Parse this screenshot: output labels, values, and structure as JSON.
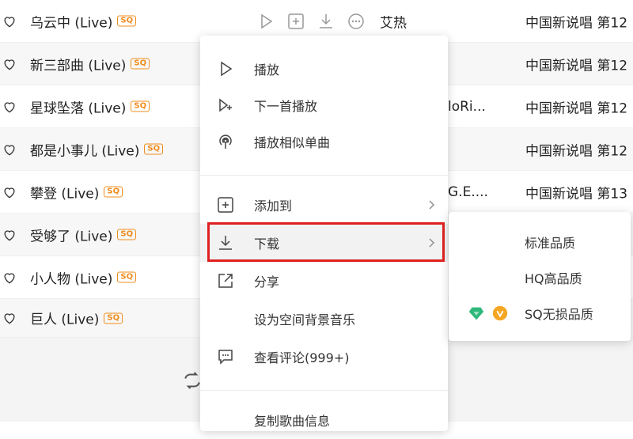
{
  "songs": [
    {
      "title": "乌云中 (Live)",
      "badge": "SQ",
      "artist": "艾热",
      "album": "中国新说唱 第12"
    },
    {
      "title": "新三部曲 (Live)",
      "badge": "SQ",
      "artist": "",
      "album": "中国新说唱 第12"
    },
    {
      "title": "星球坠落 (Live)",
      "badge": "SQ",
      "artist": "loRi...",
      "album": "中国新说唱 第12"
    },
    {
      "title": "都是小事儿 (Live)",
      "badge": "SQ",
      "artist": "",
      "album": "中国新说唱 第12"
    },
    {
      "title": "攀登 (Live)",
      "badge": "SQ",
      "artist": "G.E....",
      "album": "中国新说唱 第13"
    },
    {
      "title": "受够了 (Live)",
      "badge": "SQ",
      "artist": "",
      "album": ""
    },
    {
      "title": "小人物 (Live)",
      "badge": "SQ",
      "artist": "",
      "album": ""
    },
    {
      "title": "巨人 (Live)",
      "badge": "SQ",
      "artist": "",
      "album": ""
    }
  ],
  "context_menu": {
    "items": [
      {
        "label": "播放",
        "icon": "play-icon"
      },
      {
        "label": "下一首播放",
        "icon": "play-next-icon"
      },
      {
        "label": "播放相似单曲",
        "icon": "radio-icon"
      },
      {
        "label": "添加到",
        "icon": "add-icon"
      },
      {
        "label": "下载",
        "icon": "download-icon"
      },
      {
        "label": "分享",
        "icon": "share-icon"
      },
      {
        "label": "设为空间背景音乐",
        "icon": ""
      },
      {
        "label": "查看评论(999+)",
        "icon": "comment-icon"
      },
      {
        "label": "复制歌曲信息",
        "icon": ""
      }
    ]
  },
  "download_submenu": {
    "items": [
      {
        "label": "标准品质"
      },
      {
        "label": "HQ高品质"
      },
      {
        "label": "SQ无损品质"
      }
    ]
  },
  "colors": {
    "badge": "#f08c1e",
    "highlight_box": "#e02020",
    "gem": "#2db87a",
    "vip": "#f5a623"
  }
}
